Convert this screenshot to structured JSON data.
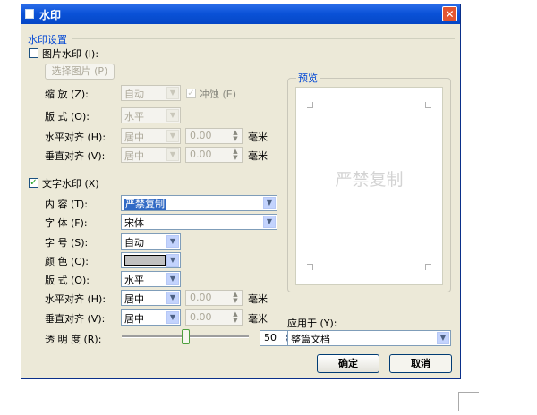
{
  "window": {
    "title": "水印",
    "close_label": "✕"
  },
  "group_title": "水印设置",
  "picture": {
    "checkbox_label": "图片水印 (I):",
    "checked": false,
    "select_button": "选择图片 (P)",
    "scale_label": "缩  放 (Z):",
    "scale_value": "自动",
    "washout_label": "冲蚀 (E)",
    "washout_checked": true,
    "layout_label": "版  式 (O):",
    "layout_value": "水平",
    "halign_label": "水平对齐 (H):",
    "halign_value": "居中",
    "halign_offset": "0.00",
    "valign_label": "垂直对齐 (V):",
    "valign_value": "居中",
    "valign_offset": "0.00",
    "unit": "毫米"
  },
  "text": {
    "checkbox_label": "文字水印 (X)",
    "checked": true,
    "content_label": "内  容 (T):",
    "content_value": "严禁复制",
    "font_label": "字  体 (F):",
    "font_value": "宋体",
    "size_label": "字  号 (S):",
    "size_value": "自动",
    "color_label": "颜  色 (C):",
    "color_swatch": "#c0c0c0",
    "layout_label": "版  式 (O):",
    "layout_value": "水平",
    "halign_label": "水平对齐 (H):",
    "halign_value": "居中",
    "halign_offset": "0.00",
    "valign_label": "垂直对齐 (V):",
    "valign_value": "居中",
    "valign_offset": "0.00",
    "unit": "毫米",
    "transparency_label": "透 明 度 (R):",
    "transparency_value": "50",
    "transparency_percent": 50,
    "percent_sign": "%"
  },
  "preview": {
    "label": "预览",
    "watermark_text": "严禁复制"
  },
  "apply": {
    "label": "应用于 (Y):",
    "value": "整篇文档"
  },
  "buttons": {
    "ok": "确定",
    "cancel": "取消"
  },
  "colors": {
    "accent_blue": "#0046d5",
    "title_bar": "#0a52d8",
    "close_red": "#e25530",
    "dialog_bg": "#ece9d8"
  }
}
